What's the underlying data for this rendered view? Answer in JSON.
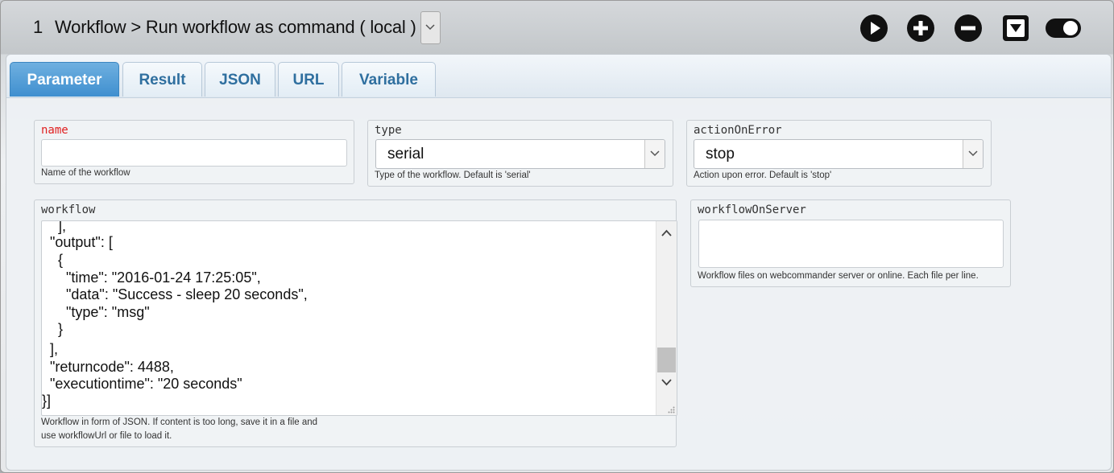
{
  "window": {
    "number": "1",
    "title": "Workflow > Run workflow as command ( local )"
  },
  "controls": {
    "run": "play-icon",
    "add": "plus-icon",
    "remove": "minus-icon",
    "collapse": "collapse-icon",
    "toggle": "toggle-icon"
  },
  "tabs": [
    {
      "label": "Parameter",
      "active": true
    },
    {
      "label": "Result",
      "active": false
    },
    {
      "label": "JSON",
      "active": false
    },
    {
      "label": "URL",
      "active": false
    },
    {
      "label": "Variable",
      "active": false
    }
  ],
  "fields": {
    "name": {
      "label": "name",
      "value": "",
      "help": "Name of the workflow",
      "required": true
    },
    "type": {
      "label": "type",
      "value": "serial",
      "help": "Type of the workflow. Default is 'serial'"
    },
    "actionOnError": {
      "label": "actionOnError",
      "value": "stop",
      "help": "Action upon error. Default is 'stop'"
    },
    "workflow": {
      "label": "workflow",
      "lines": [
        "    ],",
        "  \"output\": [",
        "    {",
        "      \"time\": \"2016-01-24 17:25:05\",",
        "      \"data\": \"Success - sleep 20 seconds\",",
        "      \"type\": \"msg\"",
        "    }",
        "  ],",
        "  \"returncode\": 4488,",
        "  \"executiontime\": \"20 seconds\"",
        "}]"
      ],
      "help_line1": "Workflow in form of JSON. If content is too long, save it in a file and",
      "help_line2": "use workflowUrl or file to load it."
    },
    "workflowOnServer": {
      "label": "workflowOnServer",
      "value": "",
      "help": "Workflow files on webcommander server or online. Each file per line."
    }
  },
  "colors": {
    "tab_active": "#4a97d3",
    "tab_text": "#2f6f9f",
    "required_label": "#e02020"
  }
}
